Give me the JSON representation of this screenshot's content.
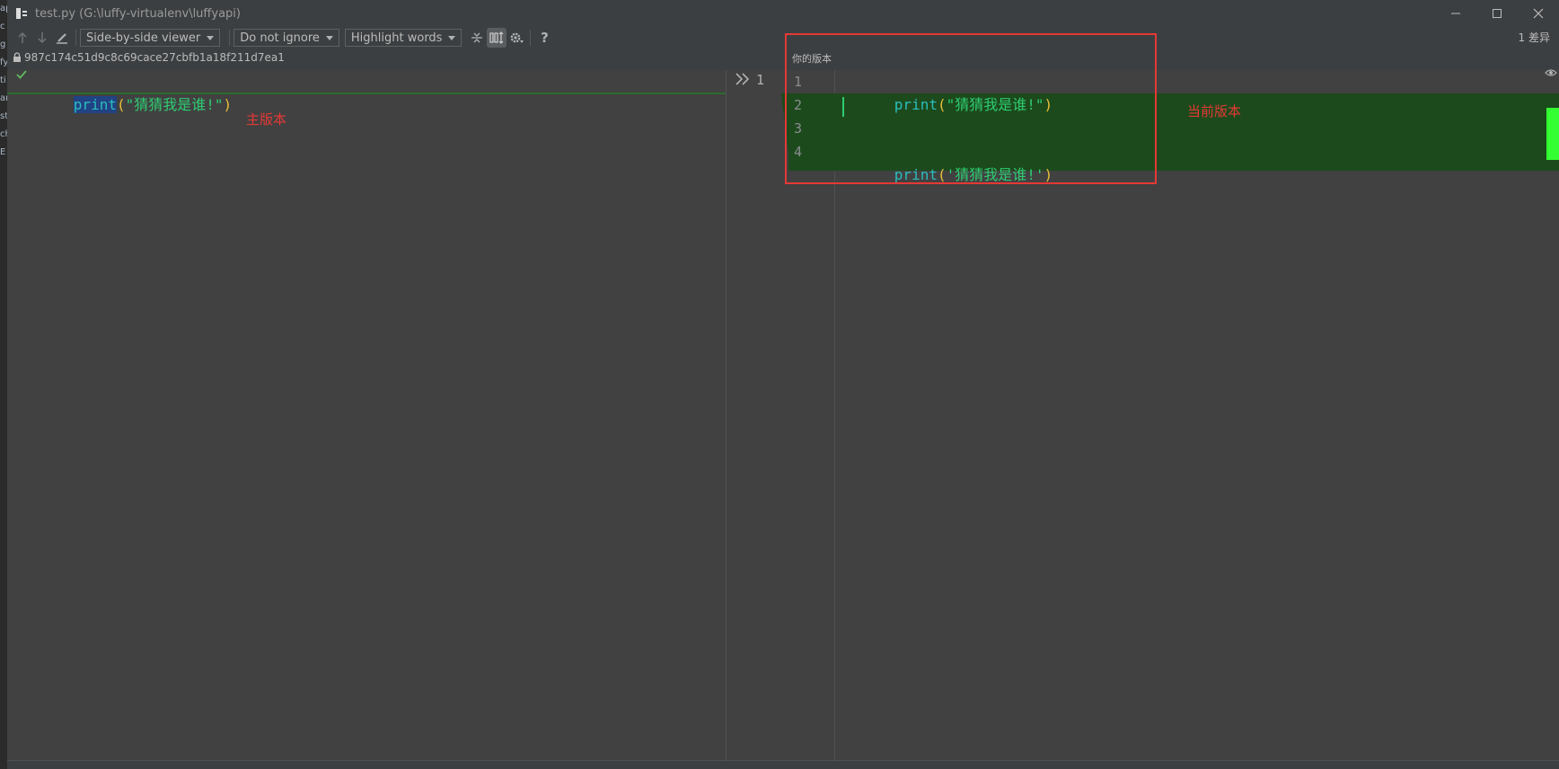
{
  "window": {
    "title": "test.py (G:\\luffy-virtualenv\\luffyapi)"
  },
  "toolbar": {
    "viewer_mode": "Side-by-side viewer",
    "ignore_mode": "Do not ignore",
    "highlight_mode": "Highlight words",
    "help_label": "?",
    "diff_count": "1 差异"
  },
  "left_pane": {
    "revision": "987c174c51d9c8c69cace27cbfb1a18f211d7ea1",
    "lines": [
      {
        "kw": "print",
        "open": "(",
        "str": "\"猜猜我是谁!\"",
        "close": ")"
      }
    ]
  },
  "middle_gutter": {
    "line_number": "1"
  },
  "right_pane": {
    "label": "你的版本",
    "line_numbers": [
      "1",
      "2",
      "3",
      "4"
    ],
    "lines": [
      {
        "kw": "print",
        "open": "(",
        "str": "\"猜猜我是谁!\"",
        "close": ")"
      },
      {
        "kw": "",
        "open": "",
        "str": "",
        "close": ""
      },
      {
        "kw": "",
        "open": "",
        "str": "",
        "close": ""
      },
      {
        "kw": "print",
        "open": "(",
        "str": "'猜猜我是谁!'",
        "close": ")"
      }
    ]
  },
  "annotations": {
    "left": "主版本",
    "right": "当前版本"
  },
  "colors": {
    "insert_band": "#1c4a1c",
    "annotation": "#e53935",
    "marker": "#33ff33"
  }
}
